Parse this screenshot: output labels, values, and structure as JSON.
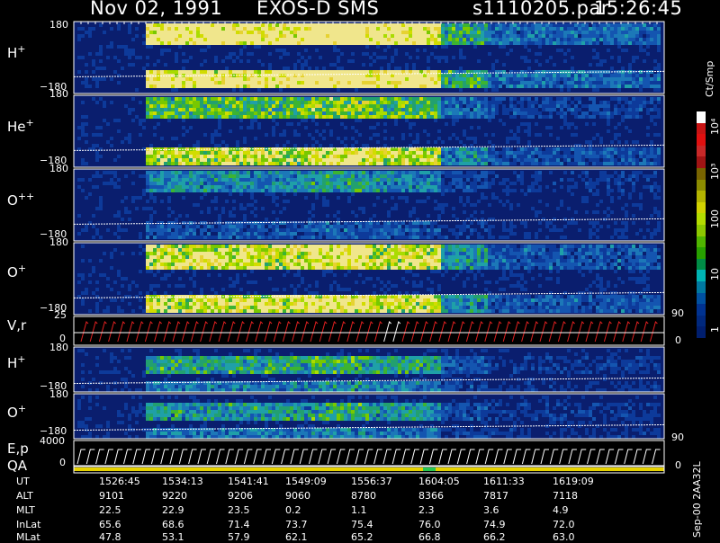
{
  "header": {
    "date": "Nov 02, 1991",
    "instrument": "EXOS-D SMS",
    "file": "s1110205.par",
    "time": "15:26:45"
  },
  "panels": [
    {
      "species": "H",
      "charge": "+",
      "top": "180",
      "bottom": "−180"
    },
    {
      "species": "He",
      "charge": "+",
      "top": "180",
      "bottom": "−180"
    },
    {
      "species": "O",
      "charge": "++",
      "top": "180",
      "bottom": "−180"
    },
    {
      "species": "O",
      "charge": "+",
      "top": "180",
      "bottom": "−180"
    },
    {
      "species": "V,r",
      "charge": "",
      "top": "25",
      "bottom": "0"
    },
    {
      "species": "H",
      "charge": "+",
      "top": "180",
      "bottom": "−180"
    },
    {
      "species": "O",
      "charge": "+",
      "top": "180",
      "bottom": "−180"
    },
    {
      "species": "E,p",
      "charge": "",
      "top": "4000",
      "bottom": "0"
    },
    {
      "species": "QA",
      "charge": "",
      "top": "",
      "bottom": ""
    }
  ],
  "right_axis": {
    "vr_top": "90",
    "vr_bottom": "0",
    "ep_top": "90",
    "ep_bottom": "0"
  },
  "colorbar": {
    "unit": "Ct/Smp",
    "ticks": [
      "10⁴",
      "10³",
      "100",
      "10",
      "1"
    ],
    "colors": [
      "#ffffff",
      "#c81414",
      "#e01010",
      "#c82828",
      "#a01414",
      "#786400",
      "#8c8c00",
      "#b4b400",
      "#d2d200",
      "#b4dc00",
      "#8cc800",
      "#50b400",
      "#28a000",
      "#008c46",
      "#00b4b4",
      "#0078a0",
      "#0050a0",
      "#003290",
      "#00287d",
      "#001e6e"
    ]
  },
  "chart_data": {
    "type": "heatmap",
    "title": "Nov 02, 1991   EXOS-D SMS",
    "panels": [
      "H+",
      "He+",
      "O++",
      "O+",
      "V,r",
      "H+",
      "O+",
      "E,p",
      "QA"
    ],
    "pitch_angle_range": [
      -180,
      180
    ],
    "colorbar_range": [
      1,
      10000
    ],
    "colorbar_scale": "log",
    "colorbar_unit": "Ct/Smp",
    "time_axis": [
      "1526:45",
      "1534:13",
      "1541:41",
      "1549:09",
      "1556:37",
      "1604:05",
      "1611:33",
      "1619:09"
    ]
  },
  "orbit_table": {
    "rows": [
      {
        "label": "UT",
        "values": [
          "1526:45",
          "1534:13",
          "1541:41",
          "1549:09",
          "1556:37",
          "1604:05",
          "1611:33",
          "1619:09"
        ]
      },
      {
        "label": "ALT",
        "values": [
          "9101",
          "9220",
          "9206",
          "9060",
          "8780",
          "8366",
          "7817",
          "7118"
        ]
      },
      {
        "label": "MLT",
        "values": [
          "22.5",
          "22.9",
          "23.5",
          "0.2",
          "1.1",
          "2.3",
          "3.6",
          "4.9"
        ]
      },
      {
        "label": "InLat",
        "values": [
          "65.6",
          "68.6",
          "71.4",
          "73.7",
          "75.4",
          "76.0",
          "74.9",
          "72.0"
        ]
      },
      {
        "label": "MLat",
        "values": [
          "47.8",
          "53.1",
          "57.9",
          "62.1",
          "65.2",
          "66.8",
          "66.2",
          "63.0"
        ]
      }
    ]
  },
  "footer_stamp": "Sep-00  2AA32L"
}
